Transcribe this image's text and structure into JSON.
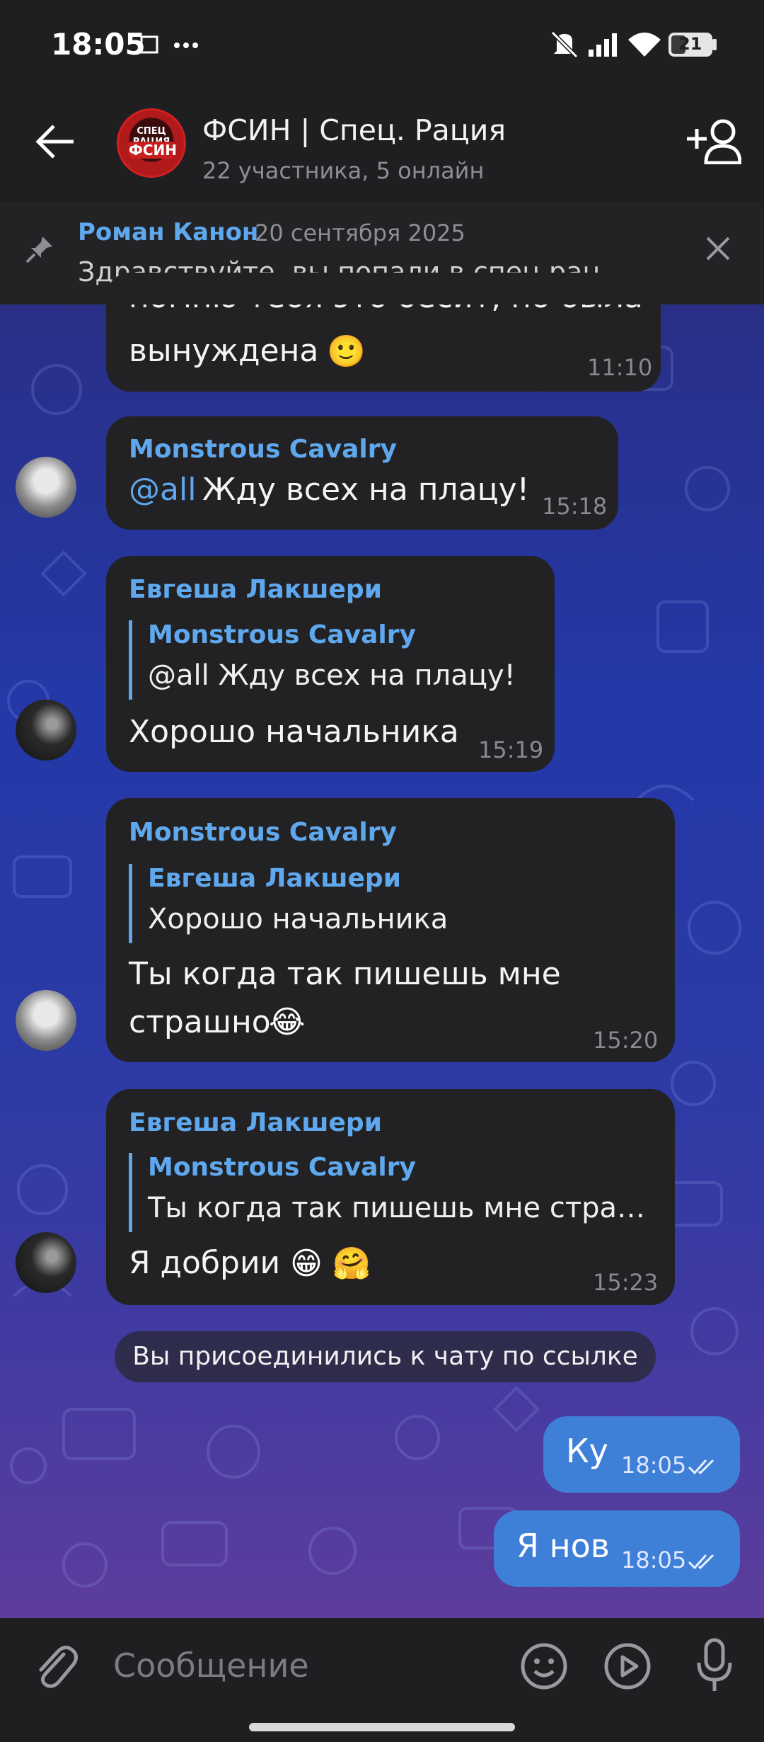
{
  "status_bar": {
    "time": "18:05",
    "icons": [
      "screenshot-icon",
      "more-dots-icon",
      "mute-icon",
      "signal-icon",
      "wifi-icon",
      "battery-icon"
    ],
    "battery": "21"
  },
  "header": {
    "title": "ФСИН | Спец. Рация",
    "subtitle": "22 участника, 5 онлайн",
    "avatar_text_top": "СПЕЦ РАЦИЯ",
    "avatar_text_main": "ФСИН"
  },
  "pinned": {
    "author": "Роман Канон",
    "date": "20 сентября 2025",
    "text": "Здравствуйте, вы попали в спец рац…"
  },
  "messages": [
    {
      "partial_text": "помню тебя это бесит, но была",
      "text": "вынуждена",
      "emoji": "🙂",
      "time": "11:10"
    },
    {
      "author": "Monstrous Cavalry",
      "mention": "@all",
      "text": "Жду всех на плацу!",
      "time": "15:18"
    },
    {
      "author": "Евгеша Лакшери",
      "reply_author": "Monstrous Cavalry",
      "reply_text": "@all Жду всех на плацу!",
      "text": "Хорошо начальника",
      "time": "15:19"
    },
    {
      "author": "Monstrous Cavalry",
      "reply_author": "Евгеша Лакшери",
      "reply_text": "Хорошо начальника",
      "text_line1": "Ты когда так пишешь мне",
      "text_line2": "страшно",
      "emoji": "😂",
      "time": "15:20"
    },
    {
      "author": "Евгеша Лакшери",
      "reply_author": "Monstrous Cavalry",
      "reply_text": "Ты когда так пишешь мне стра…",
      "text": "Я добрии",
      "emoji": "😁 🤗",
      "time": "15:23"
    }
  ],
  "system_message": "Вы присоединились к чату по ссылке",
  "outgoing": [
    {
      "text": "Ку",
      "time": "18:05"
    },
    {
      "text": "Я нов",
      "time": "18:05"
    }
  ],
  "input": {
    "placeholder": "Сообщение"
  },
  "colors": {
    "accent": "#5fa8ee",
    "outgoing_bubble": "#3e7fd8",
    "incoming_bubble": "#222224",
    "bar_bg": "#1f1f21"
  }
}
